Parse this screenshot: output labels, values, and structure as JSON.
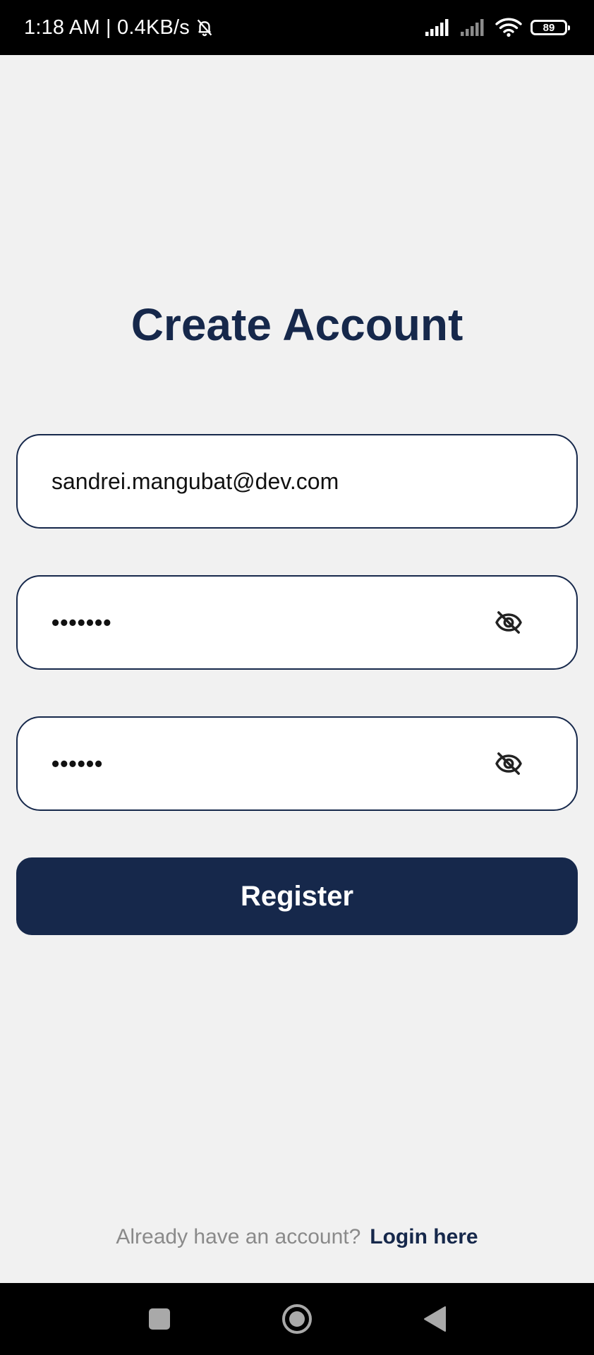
{
  "status_bar": {
    "time_speed": "1:18 AM | 0.4KB/s",
    "battery_level": "89",
    "icons": [
      "mute-bell-icon",
      "signal-icon",
      "signal-icon",
      "wifi-icon",
      "battery-icon"
    ]
  },
  "page": {
    "title": "Create Account"
  },
  "form": {
    "email_value": "sandrei.mangubat@dev.com",
    "password_mask": "•••••••",
    "confirm_password_mask": "••••••",
    "visibility_icon": "eye-off-icon"
  },
  "actions": {
    "register_label": "Register"
  },
  "footer": {
    "prompt": "Already have an account?",
    "login_link": "Login here"
  },
  "nav": {
    "icons": [
      "recents-icon",
      "home-icon",
      "back-icon"
    ]
  },
  "colors": {
    "primary": "#16284b",
    "background": "#f1f1f1",
    "muted_text": "#8a8a8a"
  }
}
